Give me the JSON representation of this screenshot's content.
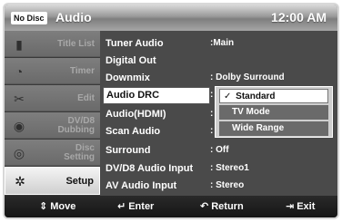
{
  "header": {
    "disc_badge": "No Disc",
    "title": "Audio",
    "clock": "12:00 AM"
  },
  "sidebar": {
    "items": [
      {
        "label": "Title List",
        "icon": "film-icon"
      },
      {
        "label": "Timer",
        "icon": "clock-icon"
      },
      {
        "label": "Edit",
        "icon": "scissors-icon"
      },
      {
        "label_line1": "DV/D8",
        "label_line2": "Dubbing",
        "icon": "disc-dubbing-icon"
      },
      {
        "label_line1": "Disc",
        "label_line2": "Setting",
        "icon": "disc-icon"
      },
      {
        "label": "Setup",
        "icon": "gear-icon",
        "active": true
      }
    ]
  },
  "menu": {
    "rows": [
      {
        "label": "Tuner Audio",
        "value": ":Main"
      },
      {
        "label": "Digital Out",
        "value": ""
      },
      {
        "label": "Downmix",
        "value": ": Dolby Surround"
      },
      {
        "label": "Audio DRC",
        "value": ":"
      },
      {
        "label": "Audio(HDMI)",
        "value": ":"
      },
      {
        "label": "Scan Audio",
        "value": ":"
      },
      {
        "label": "Surround",
        "value": ": Off"
      },
      {
        "label": "DV/D8 Audio Input",
        "value": ": Stereo1"
      },
      {
        "label": "AV Audio Input",
        "value": ": Stereo"
      }
    ],
    "selected_row": "Audio DRC"
  },
  "dropdown": {
    "check": "✓",
    "options": [
      "Standard",
      "TV Mode",
      "Wide Range"
    ],
    "selected": "Standard"
  },
  "footer": {
    "move": "Move",
    "enter": "Enter",
    "return": "Return",
    "exit": "Exit"
  },
  "colors": {
    "highlight": "#ffffff",
    "background": "#4a4a4a"
  }
}
